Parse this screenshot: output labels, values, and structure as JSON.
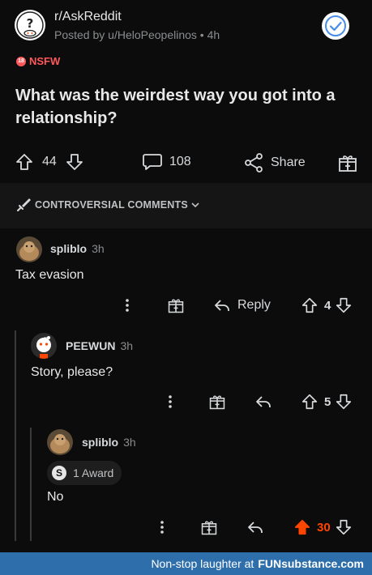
{
  "post": {
    "subreddit": "r/AskReddit",
    "posted_by": "Posted by u/HeloPeopelinos • 4h",
    "nsfw_badge": "NSFW",
    "nsfw_badge_icon_text": "18",
    "title": "What was the weirdest way you got into a relationship?",
    "upvotes": "44",
    "comments": "108",
    "share_label": "Share"
  },
  "sort": {
    "label": "CONTROVERSIAL COMMENTS"
  },
  "comments": [
    {
      "user": "spliblo",
      "time": "3h",
      "text": "Tax evasion",
      "reply_label": "Reply",
      "score": "4"
    },
    {
      "user": "PEEWUN",
      "time": "3h",
      "text": "Story, please?",
      "score": "5"
    },
    {
      "user": "spliblo",
      "time": "3h",
      "award_label": "1 Award",
      "award_icon_text": "S",
      "text": "No",
      "score": "30"
    }
  ],
  "footer": {
    "text": "Non-stop laughter at",
    "brand": "FUNsubstance.com"
  },
  "colors": {
    "accent_upvote": "#ff4500",
    "nsfw": "#ff585b",
    "footer_bg": "#2e6eab",
    "verified": "#4a8de8"
  },
  "icons": [
    "subreddit-icon",
    "verified-check-icon",
    "upvote-icon",
    "downvote-icon",
    "comment-icon",
    "share-icon",
    "gift-icon",
    "sword-icon",
    "chevron-down-icon",
    "more-icon",
    "reply-icon",
    "award-icon"
  ]
}
